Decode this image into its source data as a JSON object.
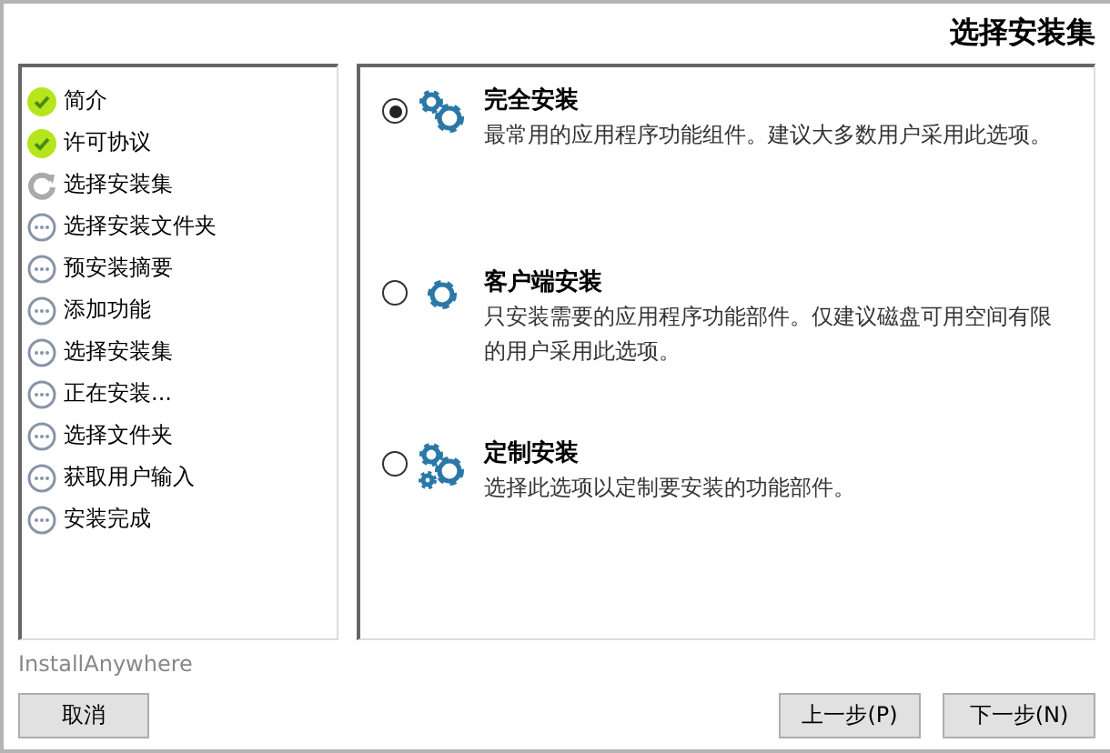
{
  "window": {
    "title": "选择安装集"
  },
  "steps": [
    {
      "label": "简介",
      "kind": "done"
    },
    {
      "label": "许可协议",
      "kind": "done"
    },
    {
      "label": "选择安装集",
      "kind": "current"
    },
    {
      "label": "选择安装文件夹",
      "kind": "pending"
    },
    {
      "label": "预安装摘要",
      "kind": "pending"
    },
    {
      "label": "添加功能",
      "kind": "pending"
    },
    {
      "label": "选择安装集",
      "kind": "pending"
    },
    {
      "label": "正在安装...",
      "kind": "pending"
    },
    {
      "label": "选择文件夹",
      "kind": "pending"
    },
    {
      "label": "获取用户输入",
      "kind": "pending"
    },
    {
      "label": "安装完成",
      "kind": "pending"
    }
  ],
  "options": [
    {
      "title": "完全安装",
      "description": "最常用的应用程序功能组件。建议大多数用户采用此选项。",
      "selected": true,
      "kind": "two-gears"
    },
    {
      "title": "客户端安装",
      "description": "只安装需要的应用程序功能部件。仅建议磁盘可用空间有限的用户采用此选项。",
      "selected": false,
      "kind": "one-gear"
    },
    {
      "title": "定制安装",
      "description": "选择此选项以定制要安装的功能部件。",
      "selected": false,
      "kind": "three-gears"
    }
  ],
  "brand": "InstallAnywhere",
  "buttons": {
    "cancel": "取消",
    "back": "上一步(P)",
    "next": "下一步(N)"
  }
}
